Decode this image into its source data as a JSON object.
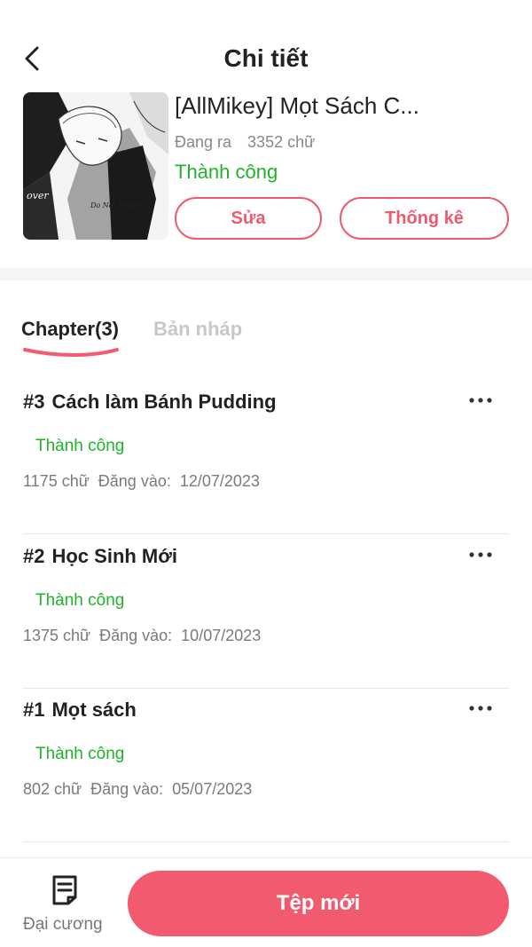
{
  "header": {
    "title": "Chi tiết"
  },
  "book": {
    "title": "[AllMikey] Mọt Sách C...",
    "state": "Đang ra",
    "words": "3352 chữ",
    "status": "Thành công",
    "edit_label": "Sửa",
    "stats_label": "Thống kê",
    "cover_text_1": "over",
    "cover_text_2": "Do Not Repost"
  },
  "tabs": {
    "chapter": "Chapter(3)",
    "draft": "Bản nháp"
  },
  "chapters": [
    {
      "number": "#3",
      "title": "Cách làm Bánh Pudding",
      "status": "Thành công",
      "words": "1175 chữ",
      "posted_label": "Đăng vào:",
      "date": "12/07/2023"
    },
    {
      "number": "#2",
      "title": "Học Sinh Mới",
      "status": "Thành công",
      "words": "1375 chữ",
      "posted_label": "Đăng vào:",
      "date": "10/07/2023"
    },
    {
      "number": "#1",
      "title": "Mọt sách",
      "status": "Thành công",
      "words": "802 chữ",
      "posted_label": "Đăng vào:",
      "date": "05/07/2023"
    }
  ],
  "bottom": {
    "outline_label": "Đại cương",
    "new_file_label": "Tệp mới"
  },
  "colors": {
    "accent": "#f25a70",
    "success": "#1fb32a",
    "muted": "#888888"
  },
  "icons": {
    "back": "chevron-left-icon",
    "more": "more-horizontal-icon",
    "outline": "document-icon"
  }
}
